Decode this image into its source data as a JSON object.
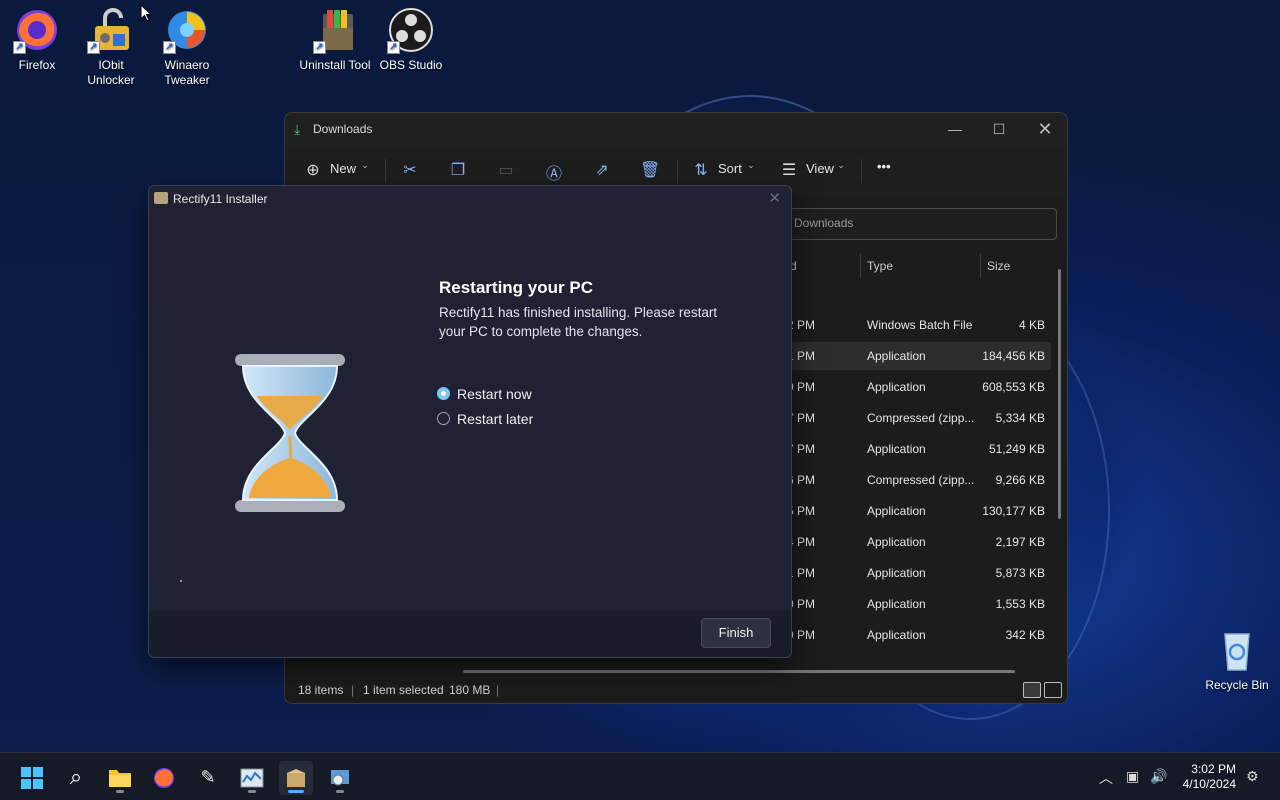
{
  "desktop": {
    "icons": [
      {
        "label": "Firefox",
        "icon": "firefox-icon"
      },
      {
        "label": "IObit Unlocker",
        "icon": "iobit-unlocker-icon"
      },
      {
        "label": "Winaero Tweaker",
        "icon": "winaero-tweaker-icon"
      },
      {
        "label": "Uninstall Tool",
        "icon": "uninstall-tool-icon"
      },
      {
        "label": "OBS Studio",
        "icon": "obs-studio-icon"
      },
      {
        "label": "Recycle Bin",
        "icon": "recycle-bin-icon"
      }
    ]
  },
  "explorer": {
    "title": "Downloads",
    "toolbar": {
      "new_label": "New",
      "sort_label": "Sort",
      "view_label": "View",
      "more_label": "•••"
    },
    "address_placeholder": "Downloads",
    "columns": {
      "date_partial": "d",
      "type": "Type",
      "size": "Size"
    },
    "rows": [
      {
        "date": "2 PM",
        "type": "Windows Batch File",
        "size": "4 KB"
      },
      {
        "date": "1 PM",
        "type": "Application",
        "size": "184,456 KB",
        "selected": true
      },
      {
        "date": "9 PM",
        "type": "Application",
        "size": "608,553 KB"
      },
      {
        "date": "7 PM",
        "type": "Compressed (zipp...",
        "size": "5,334 KB"
      },
      {
        "date": "7 PM",
        "type": "Application",
        "size": "51,249 KB"
      },
      {
        "date": "6 PM",
        "type": "Compressed (zipp...",
        "size": "9,266 KB"
      },
      {
        "date": "5 PM",
        "type": "Application",
        "size": "130,177 KB"
      },
      {
        "date": "4 PM",
        "type": "Application",
        "size": "2,197 KB"
      },
      {
        "date": "1 PM",
        "type": "Application",
        "size": "5,873 KB"
      },
      {
        "date": "0 PM",
        "type": "Application",
        "size": "1,553 KB"
      },
      {
        "date": "9 PM",
        "type": "Application",
        "size": "342 KB"
      }
    ],
    "status": {
      "items": "18 items",
      "selected": "1 item selected",
      "selected_size": "180 MB"
    }
  },
  "installer": {
    "title": "Rectify11 Installer",
    "heading": "Restarting your PC",
    "message": "Rectify11 has finished installing. Please restart your PC to complete the changes.",
    "options": [
      {
        "label": "Restart now",
        "checked": true
      },
      {
        "label": "Restart later",
        "checked": false
      }
    ],
    "finish_label": "Finish",
    "illustration": "hourglass-icon"
  },
  "taskbar": {
    "apps": [
      "start-icon",
      "search-icon",
      "file-explorer-icon",
      "firefox-icon",
      "winaero-tweaker-icon",
      "task-manager-icon",
      "rectify11-installer-icon",
      "control-panel-icon"
    ],
    "clock": {
      "time": "3:02 PM",
      "date": "4/10/2024"
    }
  },
  "colors": {
    "accent": "#5aa8ff",
    "radio_checked": "#76c6f5",
    "dialog_bg": "#202233"
  }
}
